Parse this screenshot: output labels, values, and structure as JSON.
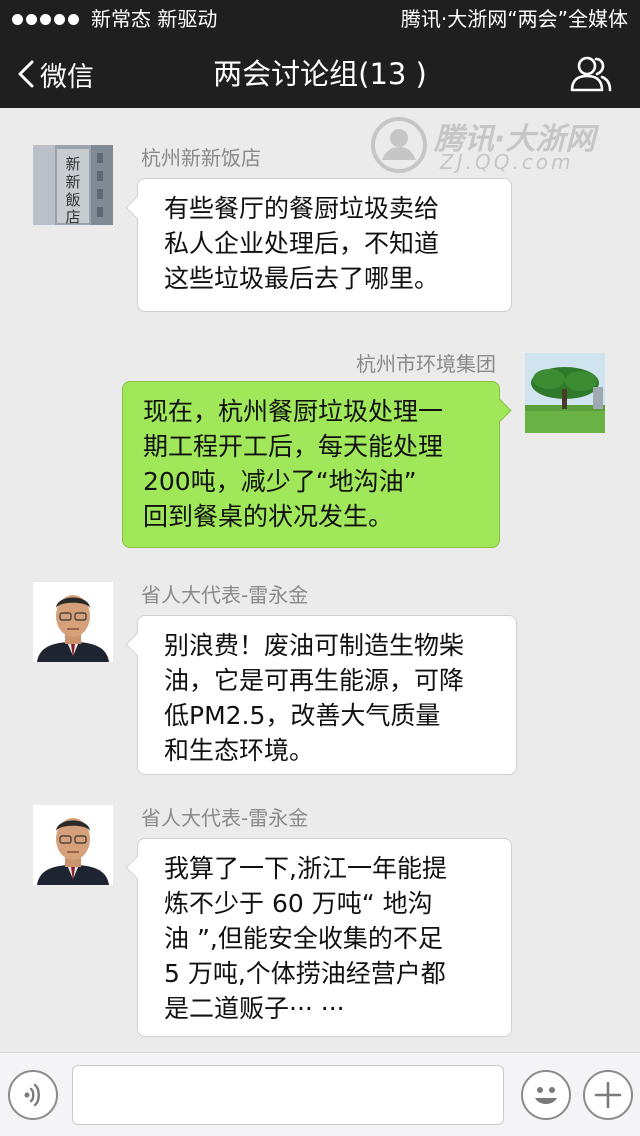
{
  "status": {
    "left_text": "新常态 新驱动",
    "right_text": "腾讯·大浙网“两会”全媒体"
  },
  "nav": {
    "back_label": "微信",
    "title": "两会讨论组(13 )"
  },
  "watermark": {
    "brand": "腾讯·大浙网",
    "domain": "ZJ.QQ.com"
  },
  "messages": [
    {
      "sender": "杭州新新饭店",
      "side": "left",
      "avatar_text": "新新飯店",
      "text": "有些餐厅的餐厨垃圾卖给\n私人企业处理后，不知道\n这些垃圾最后去了哪里。"
    },
    {
      "sender": "杭州市环境集团",
      "side": "right",
      "text": "现在，杭州餐厨垃圾处理一\n期工程开工后，每天能处理\n200吨，减少了“地沟油”\n回到餐桌的状况发生。"
    },
    {
      "sender": "省人大代表-雷永金",
      "side": "left",
      "text": "别浪费！废油可制造生物柴\n油，它是可再生能源，可降\n低PM2.5，改善大气质量\n和生态环境。"
    },
    {
      "sender": "省人大代表-雷永金",
      "side": "left",
      "text": "我算了一下,浙江一年能提\n炼不少于 60 万吨“ 地沟\n油 ”,但能安全收集的不足\n5 万吨,个体捞油经营户都\n是二道贩子··· ···"
    }
  ],
  "input": {
    "voice_icon": "voice-icon",
    "emoji_icon": "emoji-icon",
    "add_icon": "plus-icon"
  }
}
